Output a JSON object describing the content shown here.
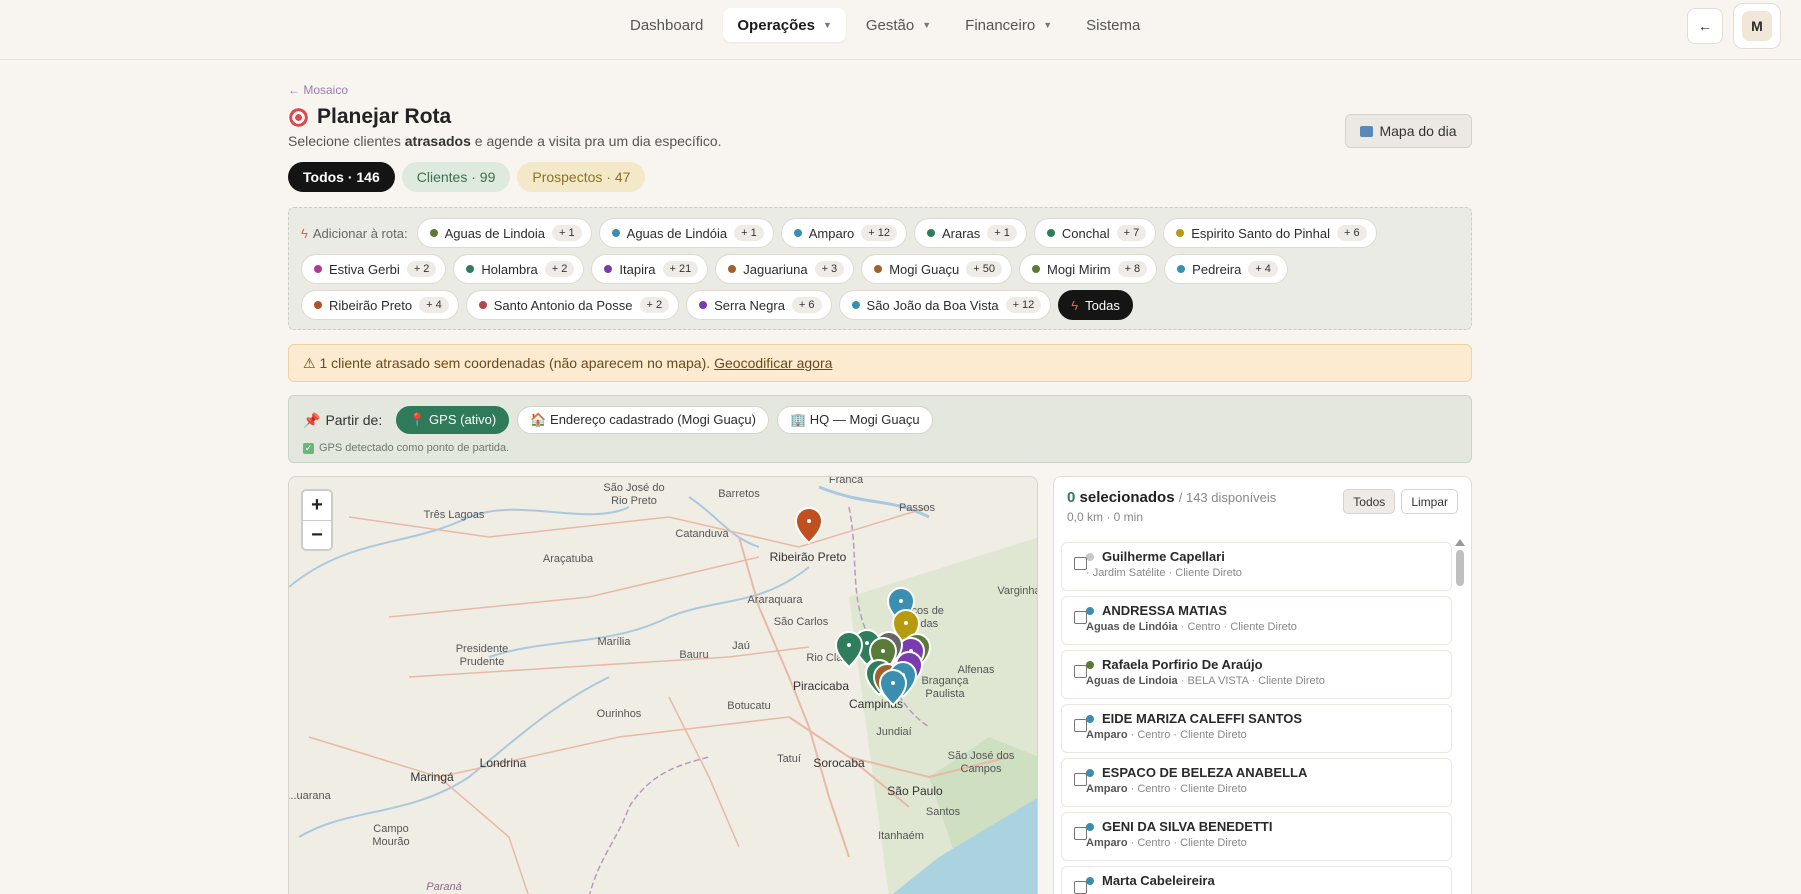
{
  "nav": {
    "items": [
      {
        "label": "Dashboard",
        "active": false,
        "dropdown": false
      },
      {
        "label": "Operações",
        "active": true,
        "dropdown": true
      },
      {
        "label": "Gestão",
        "active": false,
        "dropdown": true
      },
      {
        "label": "Financeiro",
        "active": false,
        "dropdown": true
      },
      {
        "label": "Sistema",
        "active": false,
        "dropdown": false
      }
    ],
    "back_icon_label": "←",
    "avatar_initial": "M"
  },
  "header": {
    "back_link": "← Mosaico",
    "title": "Planejar Rota",
    "subtitle_pre": "Selecione clientes ",
    "subtitle_bold": "atrasados",
    "subtitle_post": " e agende a visita pra um dia específico.",
    "map_day_button": "Mapa do dia"
  },
  "filter_tabs": [
    {
      "label": "Todos · 146",
      "active": true
    },
    {
      "label": "Clientes · 99",
      "active": false
    },
    {
      "label": "Prospectos · 47",
      "active": false
    }
  ],
  "route": {
    "label": "Adicionar à rota:",
    "chips": [
      {
        "label": "Aguas de Lindoia",
        "count": "+ 1",
        "color": "#5a7a3a"
      },
      {
        "label": "Aguas de Lindóia",
        "count": "+ 1",
        "color": "#3a8fb0"
      },
      {
        "label": "Amparo",
        "count": "+ 12",
        "color": "#3a8fb0"
      },
      {
        "label": "Araras",
        "count": "+ 1",
        "color": "#2e7d5b"
      },
      {
        "label": "Conchal",
        "count": "+ 7",
        "color": "#2e7d5b"
      },
      {
        "label": "Espirito Santo do Pinhal",
        "count": "+ 6",
        "color": "#b89a10"
      },
      {
        "label": "Estiva Gerbi",
        "count": "+ 2",
        "color": "#b03a9a"
      },
      {
        "label": "Holambra",
        "count": "+ 2",
        "color": "#2e7d5b"
      },
      {
        "label": "Itapira",
        "count": "+ 21",
        "color": "#7a3ab0"
      },
      {
        "label": "Jaguariuna",
        "count": "+ 3",
        "color": "#a0622a"
      },
      {
        "label": "Mogi Guaçu",
        "count": "+ 50",
        "color": "#a0622a"
      },
      {
        "label": "Mogi Mirim",
        "count": "+ 8",
        "color": "#5a7a3a"
      },
      {
        "label": "Pedreira",
        "count": "+ 4",
        "color": "#3a8fb0"
      },
      {
        "label": "Ribeirão Preto",
        "count": "+ 4",
        "color": "#b0522a"
      },
      {
        "label": "Santo Antonio da Posse",
        "count": "+ 2",
        "color": "#b04a4a"
      },
      {
        "label": "Serra Negra",
        "count": "+ 6",
        "color": "#7a3ab0"
      },
      {
        "label": "São João da Boa Vista",
        "count": "+ 12",
        "color": "#3a8fb0"
      }
    ],
    "all_label": "Todas"
  },
  "warning": {
    "text": "⚠ 1 cliente atrasado sem coordenadas (não aparecem no mapa).",
    "link": "Geocodificar agora"
  },
  "start": {
    "label": "Partir de:",
    "options": [
      {
        "label": "📍 GPS (ativo)",
        "active": true
      },
      {
        "label": "🏠 Endereço cadastrado (Mogi Guaçu)",
        "active": false
      },
      {
        "label": "🏢 HQ — Mogi Guaçu",
        "active": false
      }
    ],
    "note": "GPS detectado como ponto de partida."
  },
  "map": {
    "zoom_in": "+",
    "zoom_out": "−",
    "places": [
      "São José do Rio Preto",
      "Barretos",
      "Franca",
      "Passos",
      "Três Lagoas",
      "Catanduva",
      "Ribeirão Preto",
      "Araçatuba",
      "Araraquara",
      "São Carlos",
      "Poços de Caldas",
      "Varginha",
      "Presidente Prudente",
      "Marília",
      "Bauru",
      "Jaú",
      "Rio Claro",
      "Alfenas",
      "Piracicaba",
      "Campinas",
      "Botucatu",
      "Bragança Paulista",
      "Ourinhos",
      "Jundiaí",
      "Londrina",
      "Sorocaba",
      "São José dos Campos",
      "Maringá",
      "Tatuí",
      "São Paulo",
      "Santos",
      "Campo Mourão",
      "Itanhaém",
      "Paraná",
      "Apucarana"
    ]
  },
  "list": {
    "selected_count": "0",
    "selected_label": "selecionados",
    "available": "/ 143 disponíveis",
    "summary": "0,0 km · 0 min",
    "btn_all": "Todos",
    "btn_clear": "Limpar",
    "items": [
      {
        "name": "Guilherme Capellari",
        "city": "",
        "meta": "· Jardim Satélite · Cliente Direto",
        "color": "#c8c8c8"
      },
      {
        "name": "ANDRESSA MATIAS",
        "city": "Aguas de Lindóia",
        "meta": " · Centro · Cliente Direto",
        "color": "#3a8fb0"
      },
      {
        "name": "Rafaela Porfirio De Araújo",
        "city": "Aguas de Lindoia",
        "meta": " · BELA VISTA · Cliente Direto",
        "color": "#5a7a3a"
      },
      {
        "name": "EIDE MARIZA CALEFFI SANTOS",
        "city": "Amparo",
        "meta": " · Centro · Cliente Direto",
        "color": "#3a8fb0"
      },
      {
        "name": "ESPACO DE BELEZA ANABELLA",
        "city": "Amparo",
        "meta": " · Centro · Cliente Direto",
        "color": "#3a8fb0"
      },
      {
        "name": "GENI DA SILVA BENEDETTI",
        "city": "Amparo",
        "meta": " · Centro · Cliente Direto",
        "color": "#3a8fb0"
      },
      {
        "name": "Marta Cabeleireira",
        "city": "",
        "meta": "",
        "color": "#3a8fb0"
      }
    ]
  },
  "colors": {
    "accent_green": "#2f7a58",
    "warning_bg": "#fcebd1",
    "dark": "#141414"
  }
}
